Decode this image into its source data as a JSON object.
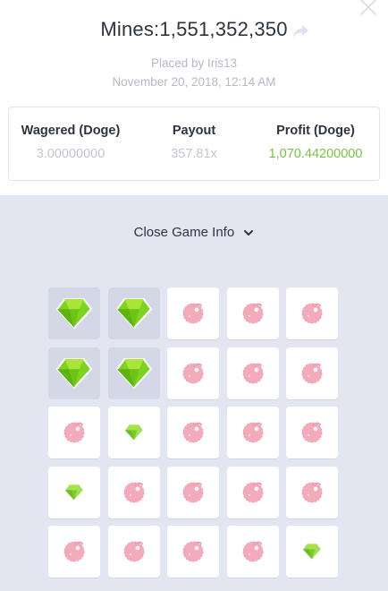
{
  "header": {
    "title": "Mines:1,551,352,350",
    "placed_by": "Placed by Iris13",
    "date": "November 20, 2018, 12:14 AM"
  },
  "stats": {
    "wagered_label": "Wagered (Doge)",
    "wagered_value": "3.00000000",
    "payout_label": "Payout",
    "payout_value": "357.81x",
    "profit_label": "Profit (Doge)",
    "profit_value": "1,070.44200000"
  },
  "toggle": {
    "label": "Close Game Info"
  },
  "colors": {
    "profit": "#7ac143",
    "gem": "#7ed321",
    "mine": "#f2a1b3",
    "background": "#e3e6f0"
  },
  "grid": {
    "rows": 5,
    "cols": 5,
    "legend": {
      "G": "gem-picked",
      "g": "gem-unpicked",
      "m": "mine"
    },
    "cells": [
      [
        "G",
        "G",
        "m",
        "m",
        "m"
      ],
      [
        "G",
        "G",
        "m",
        "m",
        "m"
      ],
      [
        "m",
        "g",
        "m",
        "m",
        "m"
      ],
      [
        "g",
        "m",
        "m",
        "m",
        "m"
      ],
      [
        "m",
        "m",
        "m",
        "m",
        "g"
      ]
    ]
  }
}
